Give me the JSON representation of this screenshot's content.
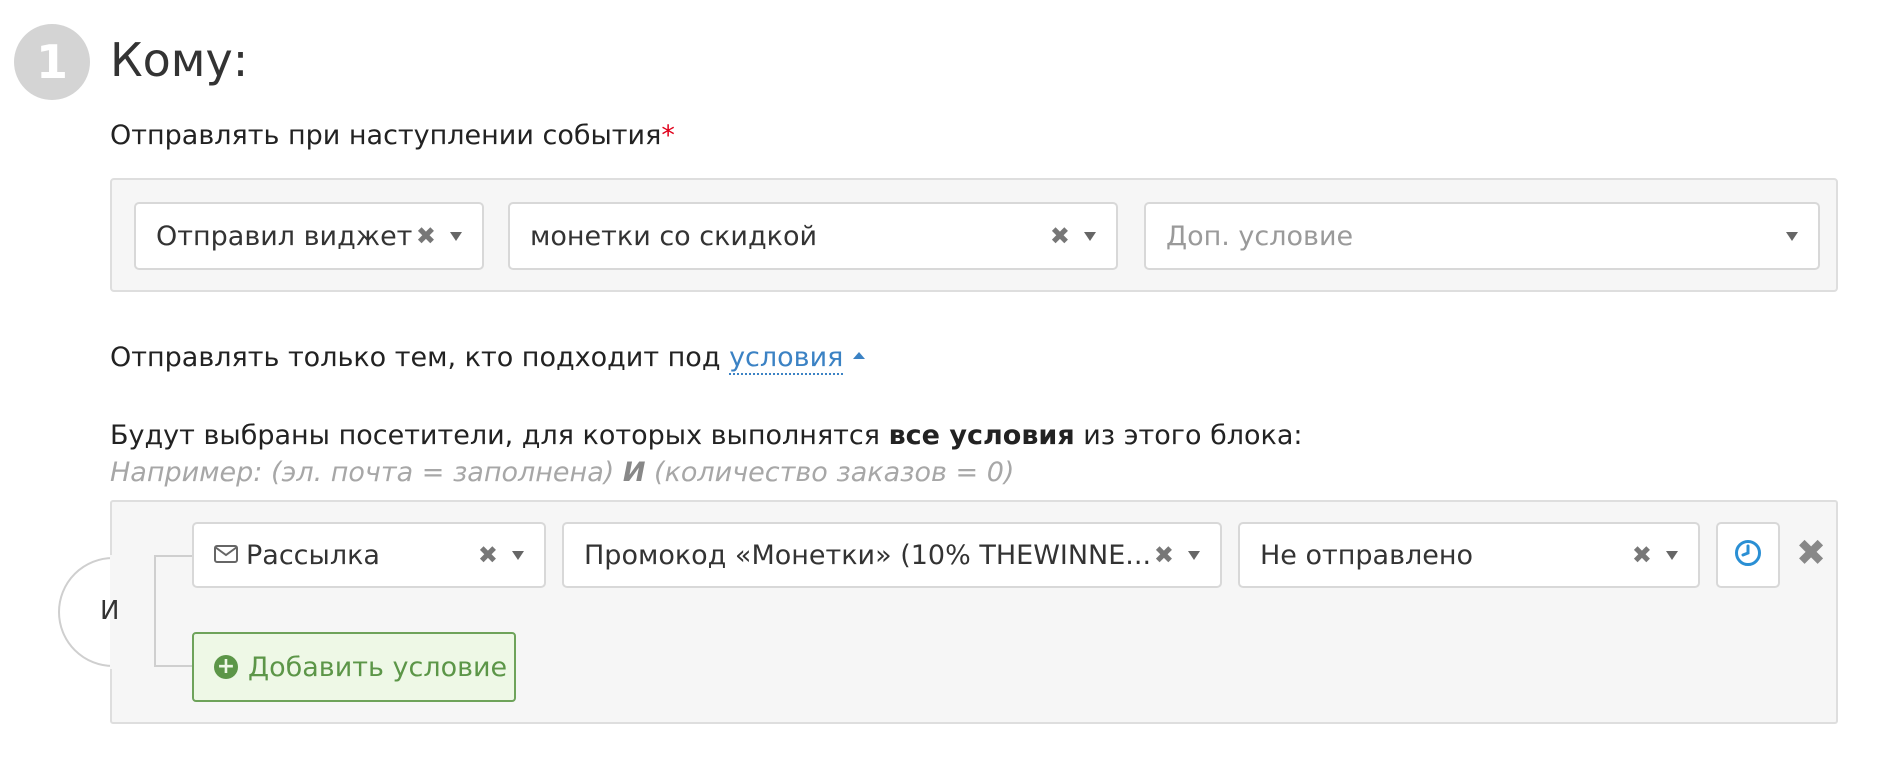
{
  "step": {
    "number": "1",
    "title": "Кому:"
  },
  "event": {
    "label": "Отправлять при наступлении события",
    "required_mark": "*",
    "selects": [
      {
        "value": "Отправил виджет",
        "has_clear": true
      },
      {
        "value": "монетки со скидкой",
        "has_clear": true
      },
      {
        "placeholder": "Доп. условие",
        "has_clear": false
      }
    ]
  },
  "filter": {
    "text": "Отправлять только тем, кто подходит под ",
    "link": "условия"
  },
  "desc": {
    "before": "Будут выбраны посетители, для которых выполнятся ",
    "bold": "все условия",
    "after": " из этого блока:",
    "example_before": "Например: (эл. почта = заполнена) ",
    "example_bold": "И",
    "example_after": " (количество заказов = 0)"
  },
  "conditions": {
    "operator": "И",
    "row": {
      "field": "Рассылка",
      "field_icon": "envelope-icon",
      "value": "Промокод «Монетки» (10% THEWINNE...",
      "status": "Не отправлено"
    },
    "add_label": "Добавить условие"
  },
  "colors": {
    "link": "#3b82c4",
    "required": "#e0001b",
    "add_button_text": "#5c9648",
    "add_button_bg": "#eef8e6",
    "clock": "#2a8fd4"
  }
}
